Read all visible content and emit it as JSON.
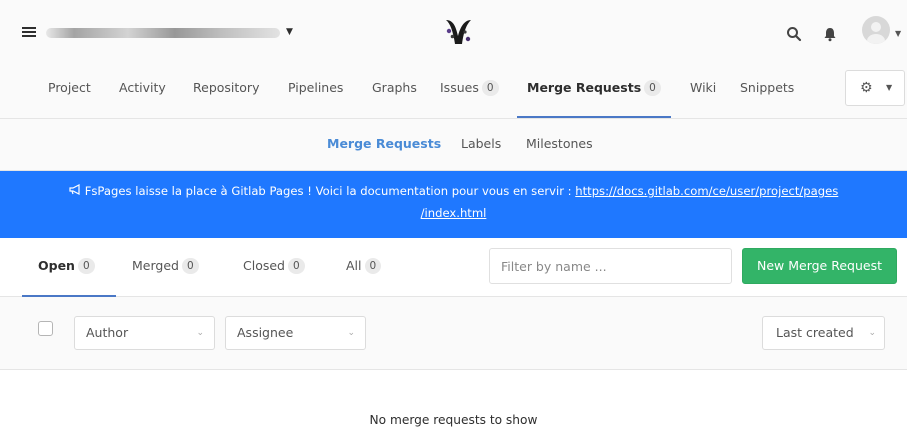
{
  "header": {
    "title_blurred": "",
    "icons": [
      "menu-icon",
      "search-icon",
      "bell-icon",
      "avatar"
    ]
  },
  "project_nav": {
    "tabs": [
      {
        "label": "Project"
      },
      {
        "label": "Activity"
      },
      {
        "label": "Repository"
      },
      {
        "label": "Pipelines"
      },
      {
        "label": "Graphs"
      },
      {
        "label": "Issues",
        "count": "0"
      },
      {
        "label": "Merge Requests",
        "count": "0",
        "active": true
      },
      {
        "label": "Wiki"
      },
      {
        "label": "Snippets"
      }
    ]
  },
  "sub_nav": {
    "items": [
      {
        "label": "Merge Requests",
        "active": true
      },
      {
        "label": "Labels"
      },
      {
        "label": "Milestones"
      }
    ]
  },
  "broadcast": {
    "text": "FsPages laisse la place à Gitlab Pages ! Voici la documentation pour vous en servir :",
    "link_line1": "https://docs.gitlab.com/ce/user/project/pages",
    "link_line2": "/index.html",
    "color": "#1f78ff"
  },
  "state_tabs": [
    {
      "label": "Open",
      "count": "0",
      "active": true
    },
    {
      "label": "Merged",
      "count": "0"
    },
    {
      "label": "Closed",
      "count": "0"
    },
    {
      "label": "All",
      "count": "0"
    }
  ],
  "filter": {
    "placeholder": "Filter by name ..."
  },
  "new_mr_button": {
    "label": "New Merge Request",
    "color": "#33b468"
  },
  "filters": {
    "author_label": "Author",
    "assignee_label": "Assignee",
    "sort_label": "Last created"
  },
  "empty_state": {
    "text": "No merge requests to show"
  }
}
